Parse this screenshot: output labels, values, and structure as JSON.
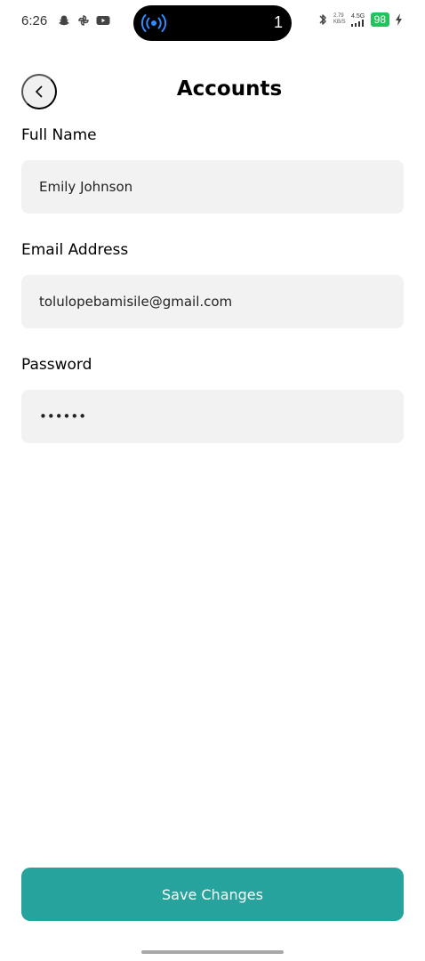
{
  "status_bar": {
    "time": "6:26",
    "left_icons": [
      "snapchat-icon",
      "pinwheel-icon",
      "youtube-icon"
    ],
    "pill_count": "1",
    "speed_top": "2.79",
    "speed_bottom": "KB/S",
    "network_label": "4.5G",
    "battery": "98",
    "battery_color": "#21c35a"
  },
  "header": {
    "title": "Accounts"
  },
  "form": {
    "full_name": {
      "label": "Full Name",
      "value": "Emily Johnson"
    },
    "email": {
      "label": "Email Address",
      "value": "tolulopebamisile@gmail.com"
    },
    "password": {
      "label": "Password",
      "value": "••••••"
    }
  },
  "actions": {
    "save_label": "Save Changes",
    "accent_color": "#26a39c"
  }
}
